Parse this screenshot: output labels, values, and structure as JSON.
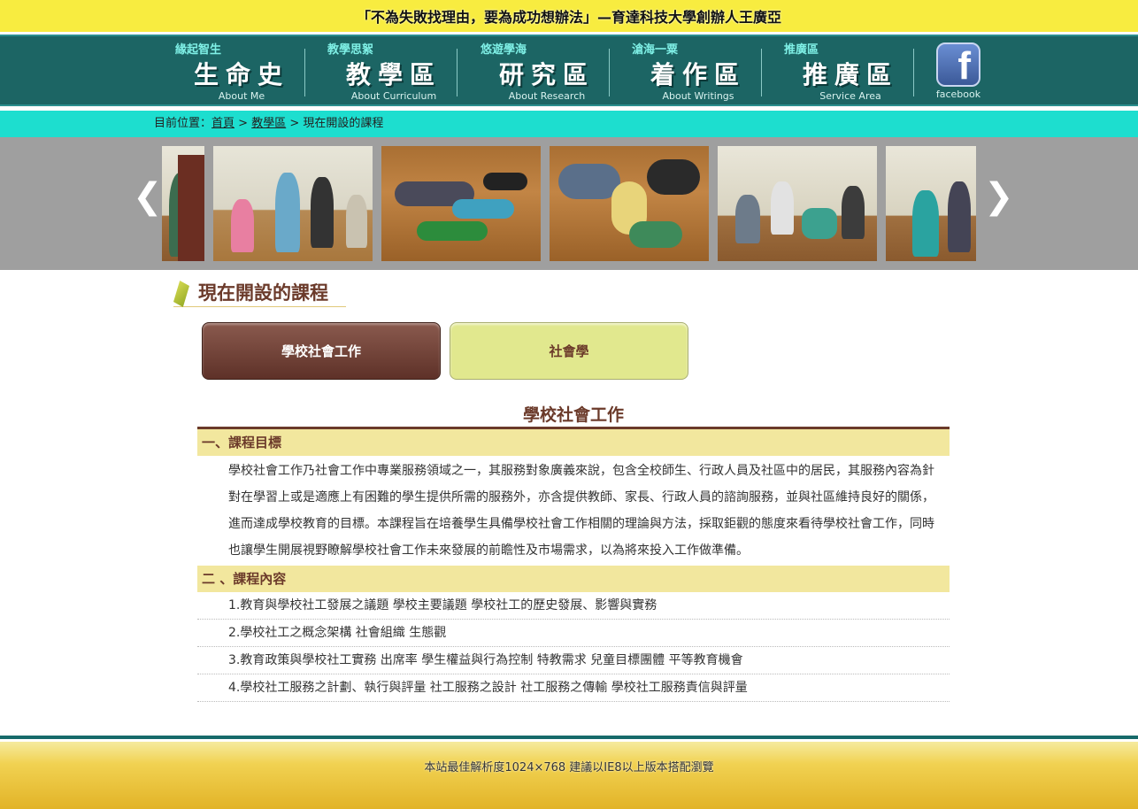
{
  "header": {
    "slogan": "「不為失敗找理由，要為成功想辦法」—育達科技大學創辦人王廣亞"
  },
  "nav": {
    "items": [
      {
        "sub": "緣起智生",
        "label": "生命史",
        "en": "About Me"
      },
      {
        "sub": "教學思絮",
        "label": "教學區",
        "en": "About Curriculum"
      },
      {
        "sub": "悠遊學海",
        "label": "研究區",
        "en": "About Research"
      },
      {
        "sub": "滄海一粟",
        "label": "着作區",
        "en": "About Writings"
      },
      {
        "sub": "推廣區",
        "label": "推廣區",
        "en": "Service Area"
      }
    ],
    "facebook_label": "facebook",
    "facebook_glyph": "f"
  },
  "breadcrumb": {
    "prefix": "目前位置：",
    "home": "首頁",
    "sep1": " > ",
    "section": "教學區",
    "sep2": " > ",
    "current": "現在開設的課程"
  },
  "gallery": {
    "prev": "❮",
    "next": "❯"
  },
  "page": {
    "title": "現在開設的課程"
  },
  "tabs": {
    "active": "學校社會工作",
    "inactive": "社會學"
  },
  "course": {
    "title": "學校社會工作",
    "section1_heading": "一、課程目標",
    "section1_body": "學校社會工作乃社會工作中專業服務領域之一，其服務對象廣義來說，包含全校師生、行政人員及社區中的居民，其服務內容為針對在學習上或是適應上有困難的學生提供所需的服務外，亦含提供教師、家長、行政人員的諮詢服務，並與社區維持良好的關係，進而達成學校教育的目標。本課程旨在培養學生具備學校社會工作相關的理論與方法，採取鉅觀的態度來看待學校社會工作，同時也讓學生開展視野瞭解學校社會工作未來發展的前瞻性及市場需求，以為將來投入工作做準備。",
    "section2_heading": "二 、課程內容",
    "items": [
      "1.教育與學校社工發展之議題 學校主要議題 學校社工的歷史發展、影響與實務",
      "2.學校社工之概念架構 社會組織 生態觀",
      "3.教育政策與學校社工實務 出席率 學生權益與行為控制 特教需求 兒童目標團體 平等教育機會",
      "4.學校社工服務之計劃、執行與評量 社工服務之設計 社工服務之傳輸 學校社工服務責信與評量"
    ]
  },
  "footer": {
    "text": "本站最佳解析度1024×768 建議以IE8以上版本搭配瀏覽"
  }
}
